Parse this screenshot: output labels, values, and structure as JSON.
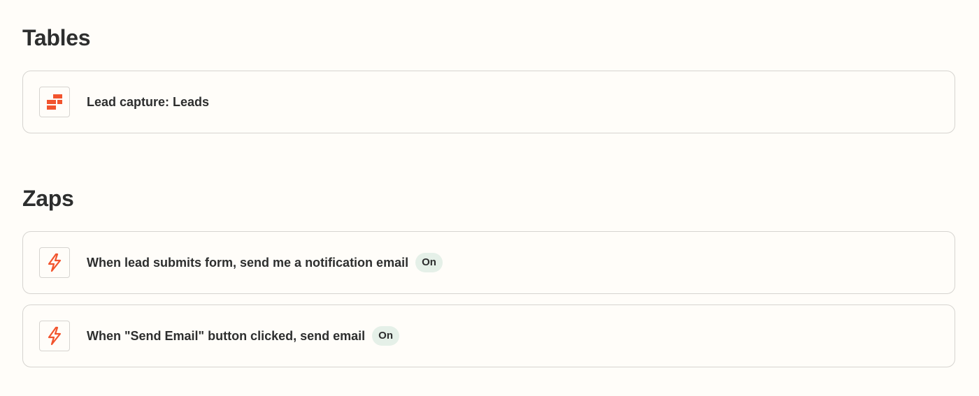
{
  "tables": {
    "heading": "Tables",
    "items": [
      {
        "label": "Lead capture: Leads",
        "icon": "tables-icon"
      }
    ]
  },
  "zaps": {
    "heading": "Zaps",
    "items": [
      {
        "label": "When lead submits form, send me a notification email",
        "status": "On",
        "icon": "zap-icon"
      },
      {
        "label": "When \"Send Email\" button clicked, send email",
        "status": "On",
        "icon": "zap-icon"
      }
    ]
  },
  "colors": {
    "accent": "#ff4f00",
    "badge_bg": "#e5f0e8",
    "background": "#fffdf9",
    "border": "#d6d4d0",
    "text": "#2d2e2e"
  }
}
